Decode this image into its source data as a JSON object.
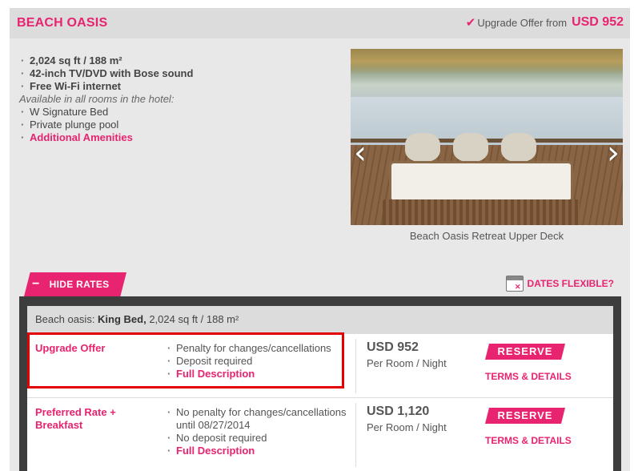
{
  "room": {
    "title": "BEACH OASIS",
    "upgrade_label": "Upgrade Offer from",
    "upgrade_price": "USD 952",
    "features": [
      "2,024 sq ft / 188 m²",
      "42-inch TV/DVD with Bose sound",
      "Free Wi-Fi internet"
    ],
    "available_label": "Available in all rooms in the hotel:",
    "hotel_amenities": [
      "W Signature Bed",
      "Private plunge pool"
    ],
    "additional_amenities": "Additional Amenities",
    "photo_caption": "Beach Oasis Retreat Upper Deck"
  },
  "controls": {
    "hide_rates": "HIDE RATES",
    "dates_flexible": "DATES FLEXIBLE?",
    "prev_arrow": "‹",
    "next_arrow": "›"
  },
  "rates": {
    "header_prefix": "Beach oasis: ",
    "header_bed": "King Bed,",
    "header_size": " 2,024 sq ft / 188 m²",
    "rows": [
      {
        "name": "Upgrade Offer",
        "notes": [
          "Penalty for changes/cancellations",
          "Deposit required"
        ],
        "link": "Full Description",
        "price": "USD 952",
        "per": "Per Room / Night",
        "reserve": "RESERVE",
        "terms": "TERMS & DETAILS"
      },
      {
        "name": "Preferred Rate + Breakfast",
        "notes": [
          "No penalty for changes/cancellations until 08/27/2014",
          "No deposit required"
        ],
        "link": "Full Description",
        "price": "USD 1,120",
        "per": "Per Room / Night",
        "reserve": "RESERVE",
        "terms": "TERMS & DETAILS"
      }
    ]
  },
  "colors": {
    "accent": "#e8236f",
    "highlight_border": "#e30000"
  }
}
